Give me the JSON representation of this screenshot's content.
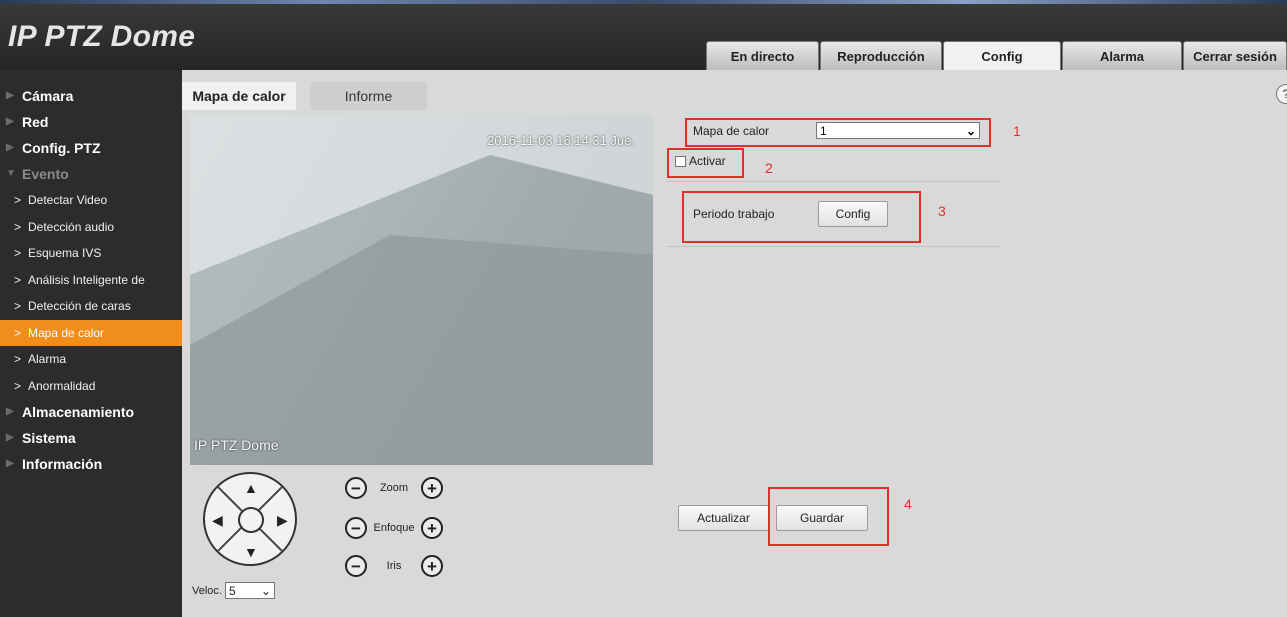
{
  "app": {
    "title": "IP PTZ Dome"
  },
  "nav": {
    "tabs": [
      {
        "label": "En directo"
      },
      {
        "label": "Reproducción"
      },
      {
        "label": "Config",
        "active": true
      },
      {
        "label": "Alarma"
      },
      {
        "label": "Cerrar sesión"
      }
    ]
  },
  "sidebar": {
    "sections": [
      {
        "label": "Cámara"
      },
      {
        "label": "Red"
      },
      {
        "label": "Config. PTZ"
      },
      {
        "label": "Evento",
        "expanded": true
      }
    ],
    "event_items": [
      {
        "label": "Detectar Video"
      },
      {
        "label": "Detección audio"
      },
      {
        "label": "Esquema IVS"
      },
      {
        "label": "Análisis Inteligente de"
      },
      {
        "label": "Detección de caras"
      },
      {
        "label": "Mapa de calor",
        "active": true
      },
      {
        "label": "Alarma"
      },
      {
        "label": "Anormalidad"
      }
    ],
    "bottom_sections": [
      {
        "label": "Almacenamiento"
      },
      {
        "label": "Sistema"
      },
      {
        "label": "Información"
      }
    ]
  },
  "subtabs": [
    {
      "label": "Mapa de calor",
      "active": true
    },
    {
      "label": "Informe"
    }
  ],
  "video": {
    "timestamp": "2016-11-03 16:14:31 Jue.",
    "osd_name": "IP PTZ Dome"
  },
  "ptz": {
    "zoom_label": "Zoom",
    "focus_label": "Enfoque",
    "iris_label": "Iris",
    "speed_label": "Veloc.",
    "speed_value": "5"
  },
  "settings": {
    "heatmap_label": "Mapa de calor",
    "heatmap_value": "1",
    "enable_label": "Activar",
    "enable_checked": false,
    "period_label": "Periodo trabajo",
    "period_button": "Config",
    "refresh_button": "Actualizar",
    "save_button": "Guardar"
  },
  "annotations": {
    "n1": "1",
    "n2": "2",
    "n3": "3",
    "n4": "4",
    "color": "#e0302c"
  },
  "colors": {
    "accent": "#f18d1b",
    "sidebar_bg": "#2c2c2c",
    "topbar_bg": "#2e2e2e"
  }
}
